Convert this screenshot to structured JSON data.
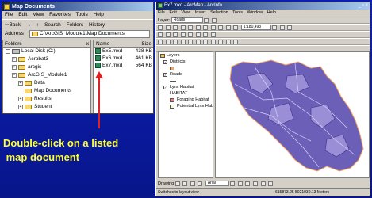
{
  "explorer": {
    "title": "Map Documents",
    "menu": [
      "File",
      "Edit",
      "View",
      "Favorites",
      "Tools",
      "Help"
    ],
    "toolbar": [
      "⇦Back",
      "→",
      "→",
      "↑",
      "Search",
      "Folders",
      "History"
    ],
    "address_label": "Address",
    "address_value": "C:\\ArcGIS_Module1\\Map Documents",
    "folders_header": "Folders",
    "folders_close": "x",
    "tree": [
      {
        "pm": "-",
        "label": "Local Disk (C:)"
      },
      {
        "pm": "+",
        "label": "Acrobat3"
      },
      {
        "pm": "+",
        "label": "arcgis"
      },
      {
        "pm": "-",
        "label": "ArcGIS_Module1"
      },
      {
        "pm": "+",
        "label": "Data"
      },
      {
        "pm": "",
        "label": "Map Documents"
      },
      {
        "pm": "+",
        "label": "Results"
      },
      {
        "pm": "+",
        "label": "Student"
      }
    ],
    "columns": {
      "name": "Name",
      "size": "Size"
    },
    "files": [
      {
        "name": "Ex5.mxd",
        "size": "438 KB"
      },
      {
        "name": "Ex6.mxd",
        "size": "461 KB"
      },
      {
        "name": "Ex7.mxd",
        "size": "564 KB"
      }
    ]
  },
  "arcmap": {
    "title": "Ex7.mxd - ArcMap - ArcInfo",
    "menu": [
      "File",
      "Edit",
      "View",
      "Insert",
      "Selection",
      "Tools",
      "Window",
      "Help"
    ],
    "layer_label": "Layer:",
    "layer_value": "Roads",
    "scale_value": "1:180,493",
    "toc": [
      {
        "label": "Layers",
        "indent": 0,
        "check": false,
        "swatch": ""
      },
      {
        "label": "Districts",
        "indent": 1,
        "check": true,
        "swatch": ""
      },
      {
        "label": "",
        "indent": 2,
        "check": false,
        "swatch": "#f4a460"
      },
      {
        "label": "Roads",
        "indent": 1,
        "check": true,
        "swatch": ""
      },
      {
        "label": "",
        "indent": 2,
        "check": false,
        "swatch": ""
      },
      {
        "label": "Lynx Habitat",
        "indent": 1,
        "check": true,
        "swatch": ""
      },
      {
        "label": "HABITAT",
        "indent": 2,
        "check": false,
        "swatch": ""
      },
      {
        "label": "Foraging Habitat",
        "indent": 2,
        "check": false,
        "swatch": "#f08080"
      },
      {
        "label": "Potential Lynx Hab",
        "indent": 2,
        "check": false,
        "swatch": "#fffacd"
      }
    ],
    "drawing_label": "Drawing",
    "font_value": "Arial",
    "status_left": "Switches to layout view",
    "status_coord": "615873.25  5021030.13 Meters",
    "map_fill": "#6b5fb8"
  },
  "callout": {
    "text_line1": "Double-click on a listed",
    "text_line2": " map document",
    "color": "#ffff33"
  }
}
